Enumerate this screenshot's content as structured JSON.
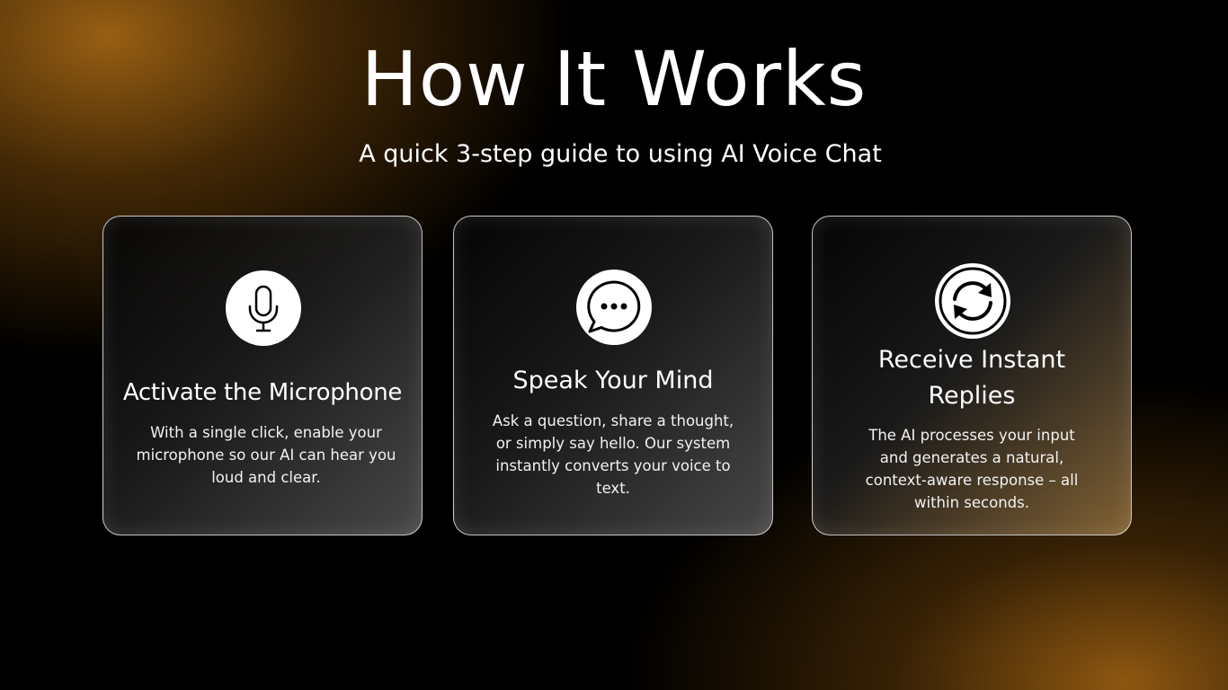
{
  "header": {
    "title": "How It Works",
    "subtitle": "A quick 3-step guide to using AI Voice Chat"
  },
  "steps": [
    {
      "icon": "microphone-icon",
      "title": "Activate the Microphone",
      "text": "With a single click, enable your microphone so our AI can hear you loud and clear."
    },
    {
      "icon": "chat-bubble-icon",
      "title": "Speak Your Mind",
      "text": "Ask a question, share a thought, or simply say hello. Our system instantly converts your voice to text."
    },
    {
      "icon": "refresh-icon",
      "title": "Receive Instant Replies",
      "text": "The AI processes your input and generates a natural, context-aware response – all within seconds."
    }
  ],
  "colors": {
    "background": "#000000",
    "accent_glow": "#A0641A",
    "text": "#FFFFFF"
  }
}
